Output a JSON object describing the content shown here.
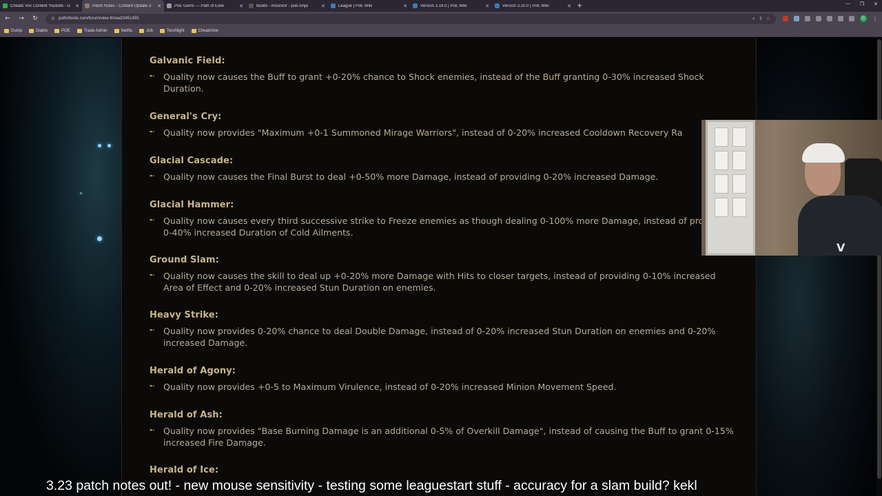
{
  "browser": {
    "tabs": [
      {
        "title": "Cheato Vox Content Youtube - G",
        "color": "#2fae4e",
        "active": false
      },
      {
        "title": "Patch Notes - Content Update 3.",
        "color": "#8a7a6a",
        "active": true
      },
      {
        "title": "PoE Gems — Path of Exile",
        "color": "#9a9a9a",
        "active": false
      },
      {
        "title": "Builds - Ancestor - poe.ninja",
        "color": "#333333",
        "active": false
      },
      {
        "title": "League | PoE Wiki",
        "color": "#3a7ab8",
        "active": false
      },
      {
        "title": "Version 3.19.0 | PoE Wiki",
        "color": "#3a7ab8",
        "active": false
      },
      {
        "title": "Version 3.20.0 | PoE Wiki",
        "color": "#3a7ab8",
        "active": false
      }
    ],
    "new_tab": "+",
    "url": "pathofexile.com/forum/view-thread/3451455",
    "profile_initial": "C",
    "bookmarks": [
      "Dump",
      "Diablo",
      "POE",
      "Trade Admin",
      "Netflix",
      "Job",
      "Torchlight",
      "CheatoVox"
    ]
  },
  "entries": [
    {
      "name": "Galvanic Field:",
      "text": "Quality now causes the Buff to grant +0-20% chance to Shock enemies, instead of the Buff granting 0-30% increased Shock Duration."
    },
    {
      "name": "General's Cry:",
      "text": "Quality now provides \"Maximum +0-1 Summoned Mirage Warriors\", instead of 0-20% increased Cooldown Recovery Ra"
    },
    {
      "name": "Glacial Cascade:",
      "text": "Quality now causes the Final Burst to deal +0-50% more Damage, instead of providing 0-20% increased Damage."
    },
    {
      "name": "Glacial Hammer:",
      "text": "Quality now causes every third successive strike to Freeze enemies as though dealing 0-100% more Damage, instead of providing 0-40% increased Duration of Cold Ailments."
    },
    {
      "name": "Ground Slam:",
      "text": "Quality now causes the skill to deal up +0-20% more Damage with Hits to closer targets, instead of providing 0-10% increased Area of Effect and 0-20% increased Stun Duration on enemies."
    },
    {
      "name": "Heavy Strike:",
      "text": "Quality now provides 0-20% chance to deal Double Damage, instead of 0-20% increased Stun Duration on enemies and 0-20% increased Damage."
    },
    {
      "name": "Herald of Agony:",
      "text": "Quality now provides +0-5 to Maximum Virulence, instead of 0-20% increased Minion Movement Speed."
    },
    {
      "name": "Herald of Ash:",
      "text": "Quality now provides \"Base Burning Damage is an additional 0-5% of Overkill Damage\", instead of causing the Buff to grant 0-15% increased Fire Damage."
    },
    {
      "name": "Herald of Ice:",
      "text": ""
    }
  ],
  "caption": "3.23 patch notes out! - new mouse sensitivity - testing some leaguestart stuff - accuracy for a slam build?  kekl"
}
